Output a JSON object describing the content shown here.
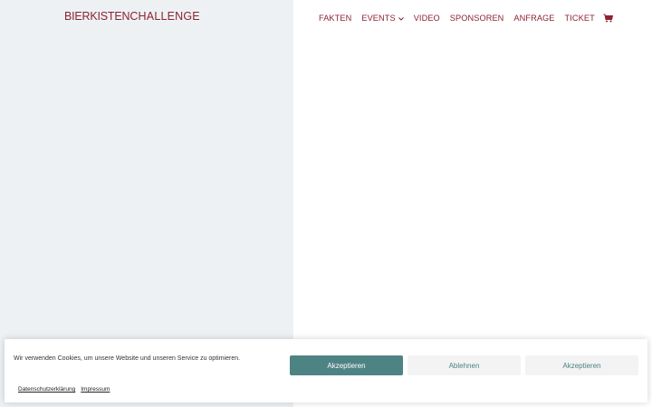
{
  "logo": {
    "part1": "BIERKISTEN",
    "part2": "CHALLENGE"
  },
  "nav": {
    "items": [
      {
        "label": "FAKTEN"
      },
      {
        "label": "EVENTS"
      },
      {
        "label": "VIDEO"
      },
      {
        "label": "SPONSOREN"
      },
      {
        "label": "ANFRAGE"
      },
      {
        "label": "TICKET"
      }
    ]
  },
  "cookie": {
    "message": "Wir verwenden Cookies, um unsere Website und unseren Service zu optimieren.",
    "accept_label": "Akzeptieren",
    "deny_label": "Ablehnen",
    "accept2_label": "Akzeptieren",
    "privacy_link": "Datenschutzerklärung",
    "imprint_link": "Impressum"
  },
  "colors": {
    "brand": "#8b2232",
    "accent": "#4e8384",
    "left_bg": "#edf1f4"
  }
}
